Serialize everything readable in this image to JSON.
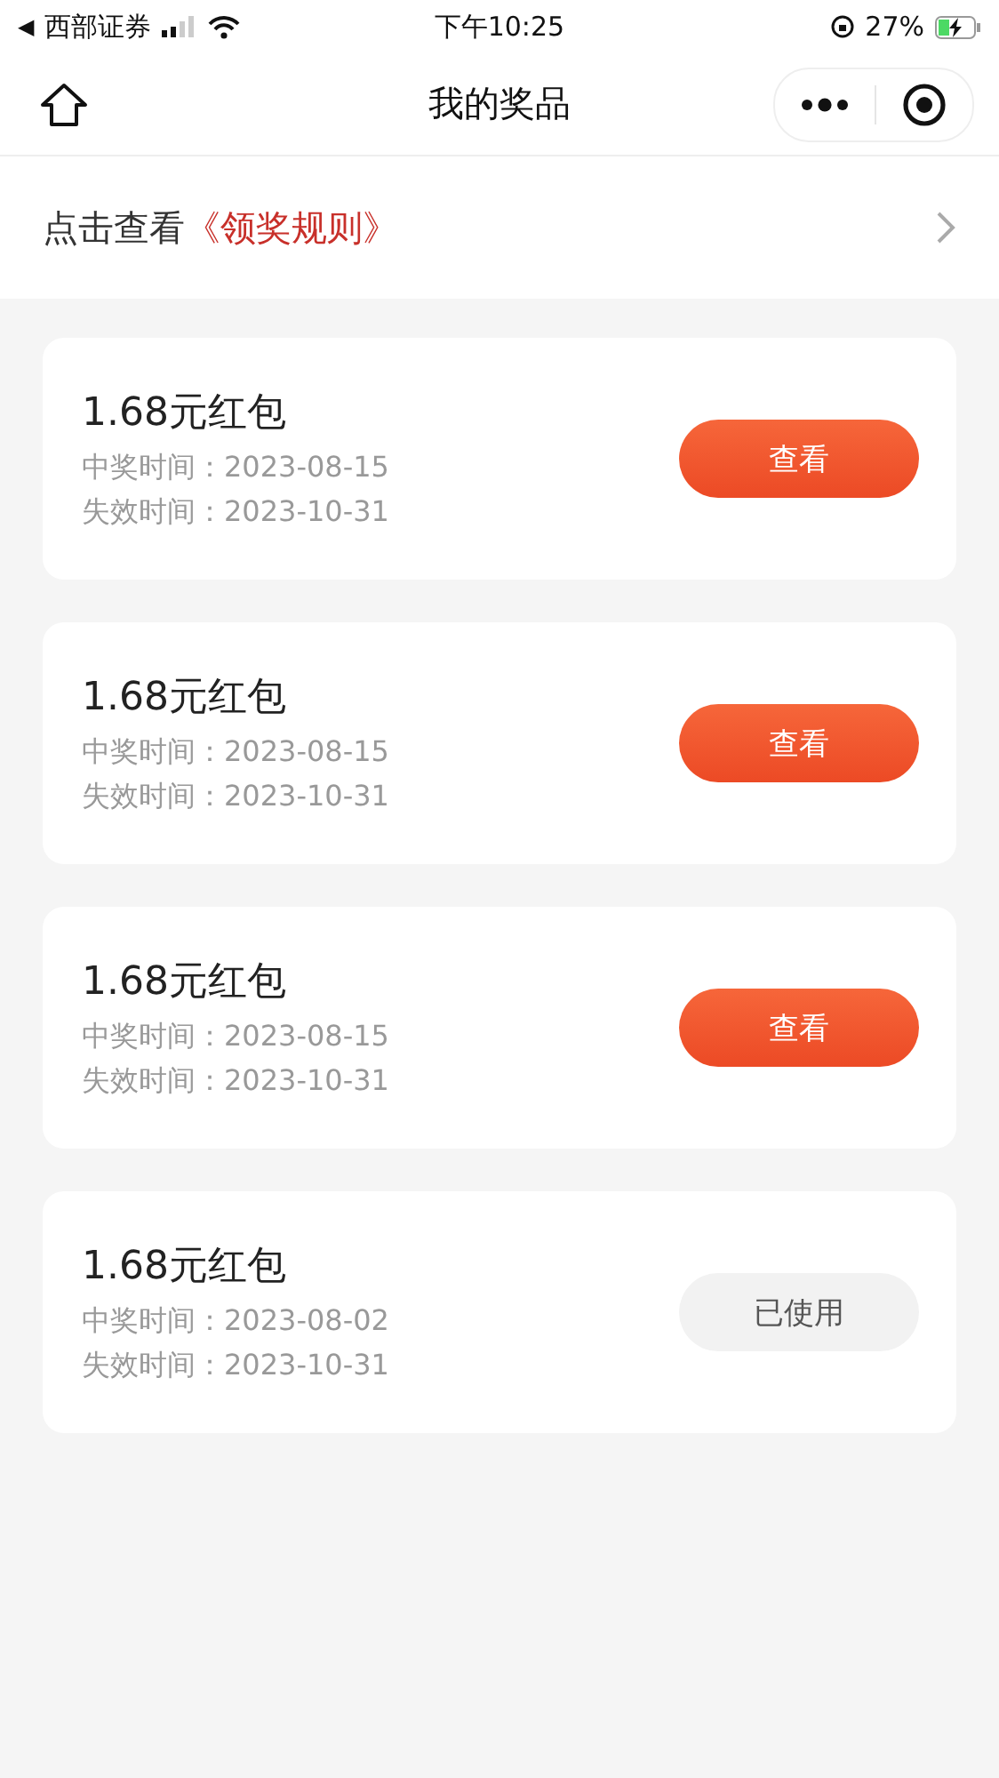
{
  "status_bar": {
    "back": "◀",
    "carrier": "西部证券",
    "time": "下午10:25",
    "battery": "27%"
  },
  "nav": {
    "title": "我的奖品"
  },
  "rules": {
    "prefix": "点击查看",
    "link": "《领奖规则》"
  },
  "prizes": [
    {
      "name": "1.68元红包",
      "won": "中奖时间：2023-08-15",
      "expires": "失效时间：2023-10-31",
      "action": "查看",
      "used": false
    },
    {
      "name": "1.68元红包",
      "won": "中奖时间：2023-08-15",
      "expires": "失效时间：2023-10-31",
      "action": "查看",
      "used": false
    },
    {
      "name": "1.68元红包",
      "won": "中奖时间：2023-08-15",
      "expires": "失效时间：2023-10-31",
      "action": "查看",
      "used": false
    },
    {
      "name": "1.68元红包",
      "won": "中奖时间：2023-08-02",
      "expires": "失效时间：2023-10-31",
      "action": "已使用",
      "used": true
    }
  ]
}
